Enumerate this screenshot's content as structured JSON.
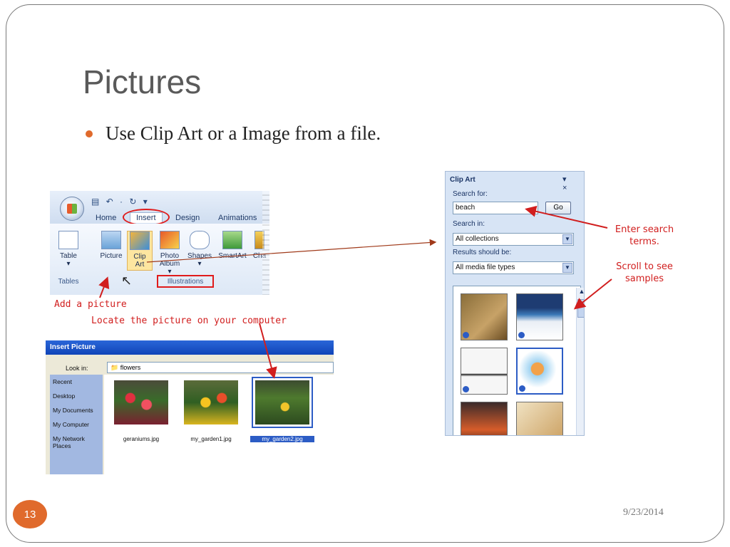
{
  "slide": {
    "title": "Pictures",
    "bullet": "Use Clip Art or a Image from a file.",
    "number": "13",
    "date": "9/23/2014"
  },
  "ribbon": {
    "qat": "▤ ↶ · ↻ ▾",
    "tabs": [
      "Home",
      "Insert",
      "Design",
      "Animations"
    ],
    "buttons": [
      {
        "label1": "Table",
        "label2": "▾"
      },
      {
        "label1": "Picture",
        "label2": ""
      },
      {
        "label1": "Clip",
        "label2": "Art"
      },
      {
        "label1": "Photo",
        "label2": "Album ▾"
      },
      {
        "label1": "Shapes",
        "label2": "▾"
      },
      {
        "label1": "SmartArt",
        "label2": ""
      },
      {
        "label1": "Cha",
        "label2": ""
      }
    ],
    "groups": [
      "Tables",
      "Illustrations"
    ]
  },
  "callouts": {
    "add_picture": "Add a picture",
    "locate": "Locate the picture on your computer",
    "enter_search": "Enter search terms.",
    "scroll": "Scroll to see samples"
  },
  "dialog": {
    "title": "Insert Picture",
    "look_in_label": "Look in:",
    "look_in_value": "flowers",
    "places": [
      "Recent",
      "Desktop",
      "My Documents",
      "My Computer",
      "My Network Places"
    ],
    "files": [
      "geraniums.jpg",
      "my_garden1.jpg",
      "my_garden2.jpg"
    ]
  },
  "clipart": {
    "title": "Clip Art",
    "controls": "▾ ×",
    "search_for_label": "Search for:",
    "search_value": "beach",
    "go_label": "Go",
    "search_in_label": "Search in:",
    "search_in_value": "All collections",
    "results_label": "Results should be:",
    "results_value": "All media file types"
  },
  "colors": {
    "accent": "#e06a2c",
    "callout_red": "#d11e1e",
    "title_gray": "#5a5a5a"
  }
}
